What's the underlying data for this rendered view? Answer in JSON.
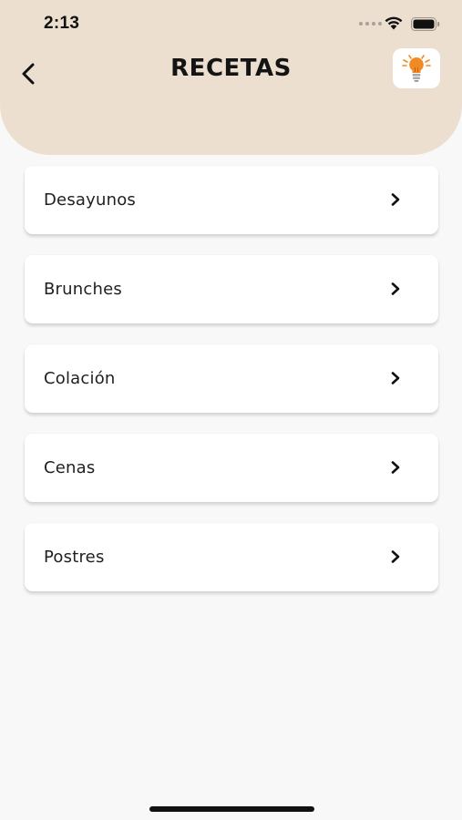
{
  "status_bar": {
    "time": "2:13"
  },
  "header": {
    "title": "RECETAS"
  },
  "categories": [
    {
      "label": "Desayunos"
    },
    {
      "label": "Brunches"
    },
    {
      "label": "Colación"
    },
    {
      "label": "Cenas"
    },
    {
      "label": "Postres"
    }
  ],
  "icons": {
    "back": "back-arrow-icon",
    "tips": "lightbulb-icon",
    "row": "chevron-right-icon"
  },
  "colors": {
    "header_background": "#ecdfcf",
    "page_background": "#f8f8f8",
    "card_background": "#ffffff",
    "lightbulb_accent": "#f08a24"
  }
}
